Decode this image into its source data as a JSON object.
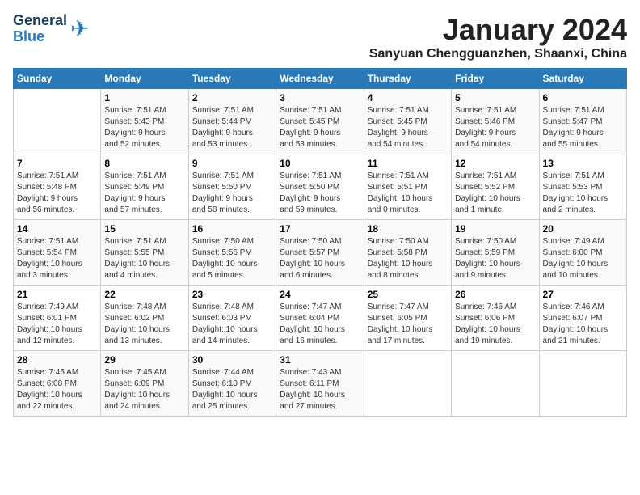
{
  "header": {
    "logo_line1": "General",
    "logo_line2": "Blue",
    "month": "January 2024",
    "location": "Sanyuan Chengguanzhen, Shaanxi, China"
  },
  "days_of_week": [
    "Sunday",
    "Monday",
    "Tuesday",
    "Wednesday",
    "Thursday",
    "Friday",
    "Saturday"
  ],
  "weeks": [
    [
      {
        "day": "",
        "info": ""
      },
      {
        "day": "1",
        "info": "Sunrise: 7:51 AM\nSunset: 5:43 PM\nDaylight: 9 hours\nand 52 minutes."
      },
      {
        "day": "2",
        "info": "Sunrise: 7:51 AM\nSunset: 5:44 PM\nDaylight: 9 hours\nand 53 minutes."
      },
      {
        "day": "3",
        "info": "Sunrise: 7:51 AM\nSunset: 5:45 PM\nDaylight: 9 hours\nand 53 minutes."
      },
      {
        "day": "4",
        "info": "Sunrise: 7:51 AM\nSunset: 5:45 PM\nDaylight: 9 hours\nand 54 minutes."
      },
      {
        "day": "5",
        "info": "Sunrise: 7:51 AM\nSunset: 5:46 PM\nDaylight: 9 hours\nand 54 minutes."
      },
      {
        "day": "6",
        "info": "Sunrise: 7:51 AM\nSunset: 5:47 PM\nDaylight: 9 hours\nand 55 minutes."
      }
    ],
    [
      {
        "day": "7",
        "info": "Sunrise: 7:51 AM\nSunset: 5:48 PM\nDaylight: 9 hours\nand 56 minutes."
      },
      {
        "day": "8",
        "info": "Sunrise: 7:51 AM\nSunset: 5:49 PM\nDaylight: 9 hours\nand 57 minutes."
      },
      {
        "day": "9",
        "info": "Sunrise: 7:51 AM\nSunset: 5:50 PM\nDaylight: 9 hours\nand 58 minutes."
      },
      {
        "day": "10",
        "info": "Sunrise: 7:51 AM\nSunset: 5:50 PM\nDaylight: 9 hours\nand 59 minutes."
      },
      {
        "day": "11",
        "info": "Sunrise: 7:51 AM\nSunset: 5:51 PM\nDaylight: 10 hours\nand 0 minutes."
      },
      {
        "day": "12",
        "info": "Sunrise: 7:51 AM\nSunset: 5:52 PM\nDaylight: 10 hours\nand 1 minute."
      },
      {
        "day": "13",
        "info": "Sunrise: 7:51 AM\nSunset: 5:53 PM\nDaylight: 10 hours\nand 2 minutes."
      }
    ],
    [
      {
        "day": "14",
        "info": "Sunrise: 7:51 AM\nSunset: 5:54 PM\nDaylight: 10 hours\nand 3 minutes."
      },
      {
        "day": "15",
        "info": "Sunrise: 7:51 AM\nSunset: 5:55 PM\nDaylight: 10 hours\nand 4 minutes."
      },
      {
        "day": "16",
        "info": "Sunrise: 7:50 AM\nSunset: 5:56 PM\nDaylight: 10 hours\nand 5 minutes."
      },
      {
        "day": "17",
        "info": "Sunrise: 7:50 AM\nSunset: 5:57 PM\nDaylight: 10 hours\nand 6 minutes."
      },
      {
        "day": "18",
        "info": "Sunrise: 7:50 AM\nSunset: 5:58 PM\nDaylight: 10 hours\nand 8 minutes."
      },
      {
        "day": "19",
        "info": "Sunrise: 7:50 AM\nSunset: 5:59 PM\nDaylight: 10 hours\nand 9 minutes."
      },
      {
        "day": "20",
        "info": "Sunrise: 7:49 AM\nSunset: 6:00 PM\nDaylight: 10 hours\nand 10 minutes."
      }
    ],
    [
      {
        "day": "21",
        "info": "Sunrise: 7:49 AM\nSunset: 6:01 PM\nDaylight: 10 hours\nand 12 minutes."
      },
      {
        "day": "22",
        "info": "Sunrise: 7:48 AM\nSunset: 6:02 PM\nDaylight: 10 hours\nand 13 minutes."
      },
      {
        "day": "23",
        "info": "Sunrise: 7:48 AM\nSunset: 6:03 PM\nDaylight: 10 hours\nand 14 minutes."
      },
      {
        "day": "24",
        "info": "Sunrise: 7:47 AM\nSunset: 6:04 PM\nDaylight: 10 hours\nand 16 minutes."
      },
      {
        "day": "25",
        "info": "Sunrise: 7:47 AM\nSunset: 6:05 PM\nDaylight: 10 hours\nand 17 minutes."
      },
      {
        "day": "26",
        "info": "Sunrise: 7:46 AM\nSunset: 6:06 PM\nDaylight: 10 hours\nand 19 minutes."
      },
      {
        "day": "27",
        "info": "Sunrise: 7:46 AM\nSunset: 6:07 PM\nDaylight: 10 hours\nand 21 minutes."
      }
    ],
    [
      {
        "day": "28",
        "info": "Sunrise: 7:45 AM\nSunset: 6:08 PM\nDaylight: 10 hours\nand 22 minutes."
      },
      {
        "day": "29",
        "info": "Sunrise: 7:45 AM\nSunset: 6:09 PM\nDaylight: 10 hours\nand 24 minutes."
      },
      {
        "day": "30",
        "info": "Sunrise: 7:44 AM\nSunset: 6:10 PM\nDaylight: 10 hours\nand 25 minutes."
      },
      {
        "day": "31",
        "info": "Sunrise: 7:43 AM\nSunset: 6:11 PM\nDaylight: 10 hours\nand 27 minutes."
      },
      {
        "day": "",
        "info": ""
      },
      {
        "day": "",
        "info": ""
      },
      {
        "day": "",
        "info": ""
      }
    ]
  ]
}
